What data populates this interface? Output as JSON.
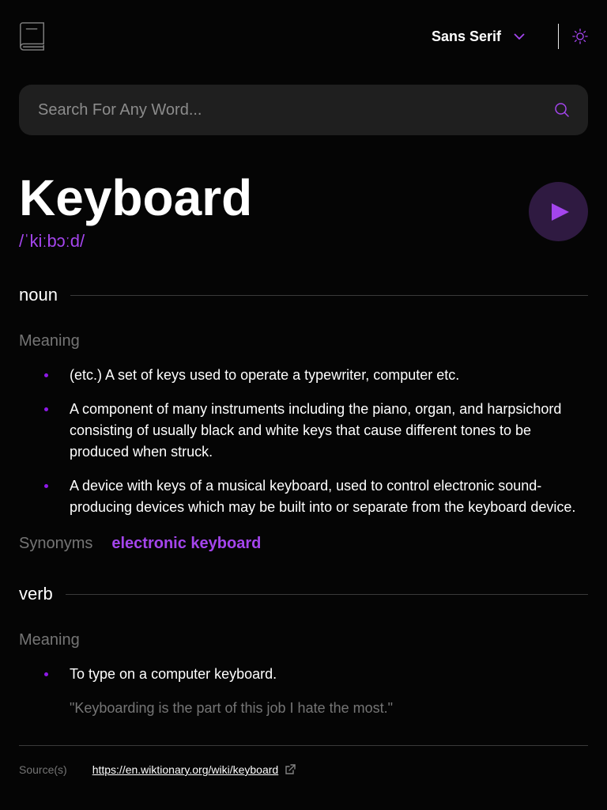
{
  "colors": {
    "accent": "#a445ed",
    "background": "#050505",
    "muted": "#757575",
    "search_bg": "#1f1f1f"
  },
  "header": {
    "logo_icon": "book-icon",
    "font_selector": {
      "selected": "Sans Serif",
      "icon": "chevron-down-icon"
    },
    "theme_toggle_icon": "sun-icon"
  },
  "search": {
    "placeholder": "Search For Any Word...",
    "value": "",
    "icon": "search-icon"
  },
  "entry": {
    "word": "Keyboard",
    "phonetic": "/ˈkiːbɔːd/",
    "play_icon": "play-icon"
  },
  "meanings": [
    {
      "part_of_speech": "noun",
      "heading": "Meaning",
      "definitions": [
        "(etc.) A set of keys used to operate a typewriter, computer etc.",
        "A component of many instruments including the piano, organ, and harpsichord consisting of usually black and white keys that cause different tones to be produced when struck.",
        "A device with keys of a musical keyboard, used to control electronic sound-producing devices which may be built into or separate from the keyboard device."
      ],
      "synonyms_label": "Synonyms",
      "synonyms": [
        "electronic keyboard"
      ]
    },
    {
      "part_of_speech": "verb",
      "heading": "Meaning",
      "definitions": [
        "To type on a computer keyboard."
      ],
      "example": "\"Keyboarding is the part of this job I hate the most.\""
    }
  ],
  "source": {
    "label": "Source(s)",
    "url": "https://en.wiktionary.org/wiki/keyboard",
    "icon": "external-link-icon"
  }
}
